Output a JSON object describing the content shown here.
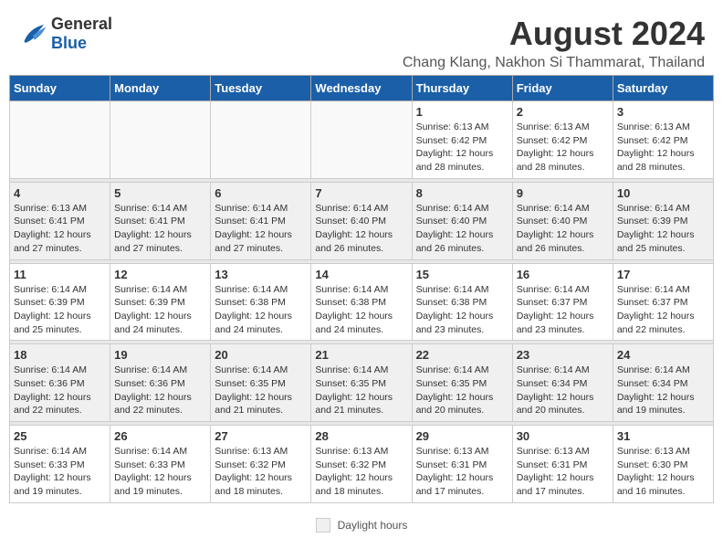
{
  "logo": {
    "general": "General",
    "blue": "Blue"
  },
  "title": "August 2024",
  "location": "Chang Klang, Nakhon Si Thammarat, Thailand",
  "days_of_week": [
    "Sunday",
    "Monday",
    "Tuesday",
    "Wednesday",
    "Thursday",
    "Friday",
    "Saturday"
  ],
  "legend_label": "Daylight hours",
  "weeks": [
    [
      {
        "day": "",
        "info": ""
      },
      {
        "day": "",
        "info": ""
      },
      {
        "day": "",
        "info": ""
      },
      {
        "day": "",
        "info": ""
      },
      {
        "day": "1",
        "info": "Sunrise: 6:13 AM\nSunset: 6:42 PM\nDaylight: 12 hours\nand 28 minutes."
      },
      {
        "day": "2",
        "info": "Sunrise: 6:13 AM\nSunset: 6:42 PM\nDaylight: 12 hours\nand 28 minutes."
      },
      {
        "day": "3",
        "info": "Sunrise: 6:13 AM\nSunset: 6:42 PM\nDaylight: 12 hours\nand 28 minutes."
      }
    ],
    [
      {
        "day": "4",
        "info": "Sunrise: 6:13 AM\nSunset: 6:41 PM\nDaylight: 12 hours\nand 27 minutes."
      },
      {
        "day": "5",
        "info": "Sunrise: 6:14 AM\nSunset: 6:41 PM\nDaylight: 12 hours\nand 27 minutes."
      },
      {
        "day": "6",
        "info": "Sunrise: 6:14 AM\nSunset: 6:41 PM\nDaylight: 12 hours\nand 27 minutes."
      },
      {
        "day": "7",
        "info": "Sunrise: 6:14 AM\nSunset: 6:40 PM\nDaylight: 12 hours\nand 26 minutes."
      },
      {
        "day": "8",
        "info": "Sunrise: 6:14 AM\nSunset: 6:40 PM\nDaylight: 12 hours\nand 26 minutes."
      },
      {
        "day": "9",
        "info": "Sunrise: 6:14 AM\nSunset: 6:40 PM\nDaylight: 12 hours\nand 26 minutes."
      },
      {
        "day": "10",
        "info": "Sunrise: 6:14 AM\nSunset: 6:39 PM\nDaylight: 12 hours\nand 25 minutes."
      }
    ],
    [
      {
        "day": "11",
        "info": "Sunrise: 6:14 AM\nSunset: 6:39 PM\nDaylight: 12 hours\nand 25 minutes."
      },
      {
        "day": "12",
        "info": "Sunrise: 6:14 AM\nSunset: 6:39 PM\nDaylight: 12 hours\nand 24 minutes."
      },
      {
        "day": "13",
        "info": "Sunrise: 6:14 AM\nSunset: 6:38 PM\nDaylight: 12 hours\nand 24 minutes."
      },
      {
        "day": "14",
        "info": "Sunrise: 6:14 AM\nSunset: 6:38 PM\nDaylight: 12 hours\nand 24 minutes."
      },
      {
        "day": "15",
        "info": "Sunrise: 6:14 AM\nSunset: 6:38 PM\nDaylight: 12 hours\nand 23 minutes."
      },
      {
        "day": "16",
        "info": "Sunrise: 6:14 AM\nSunset: 6:37 PM\nDaylight: 12 hours\nand 23 minutes."
      },
      {
        "day": "17",
        "info": "Sunrise: 6:14 AM\nSunset: 6:37 PM\nDaylight: 12 hours\nand 22 minutes."
      }
    ],
    [
      {
        "day": "18",
        "info": "Sunrise: 6:14 AM\nSunset: 6:36 PM\nDaylight: 12 hours\nand 22 minutes."
      },
      {
        "day": "19",
        "info": "Sunrise: 6:14 AM\nSunset: 6:36 PM\nDaylight: 12 hours\nand 22 minutes."
      },
      {
        "day": "20",
        "info": "Sunrise: 6:14 AM\nSunset: 6:35 PM\nDaylight: 12 hours\nand 21 minutes."
      },
      {
        "day": "21",
        "info": "Sunrise: 6:14 AM\nSunset: 6:35 PM\nDaylight: 12 hours\nand 21 minutes."
      },
      {
        "day": "22",
        "info": "Sunrise: 6:14 AM\nSunset: 6:35 PM\nDaylight: 12 hours\nand 20 minutes."
      },
      {
        "day": "23",
        "info": "Sunrise: 6:14 AM\nSunset: 6:34 PM\nDaylight: 12 hours\nand 20 minutes."
      },
      {
        "day": "24",
        "info": "Sunrise: 6:14 AM\nSunset: 6:34 PM\nDaylight: 12 hours\nand 19 minutes."
      }
    ],
    [
      {
        "day": "25",
        "info": "Sunrise: 6:14 AM\nSunset: 6:33 PM\nDaylight: 12 hours\nand 19 minutes."
      },
      {
        "day": "26",
        "info": "Sunrise: 6:14 AM\nSunset: 6:33 PM\nDaylight: 12 hours\nand 19 minutes."
      },
      {
        "day": "27",
        "info": "Sunrise: 6:13 AM\nSunset: 6:32 PM\nDaylight: 12 hours\nand 18 minutes."
      },
      {
        "day": "28",
        "info": "Sunrise: 6:13 AM\nSunset: 6:32 PM\nDaylight: 12 hours\nand 18 minutes."
      },
      {
        "day": "29",
        "info": "Sunrise: 6:13 AM\nSunset: 6:31 PM\nDaylight: 12 hours\nand 17 minutes."
      },
      {
        "day": "30",
        "info": "Sunrise: 6:13 AM\nSunset: 6:31 PM\nDaylight: 12 hours\nand 17 minutes."
      },
      {
        "day": "31",
        "info": "Sunrise: 6:13 AM\nSunset: 6:30 PM\nDaylight: 12 hours\nand 16 minutes."
      }
    ]
  ]
}
